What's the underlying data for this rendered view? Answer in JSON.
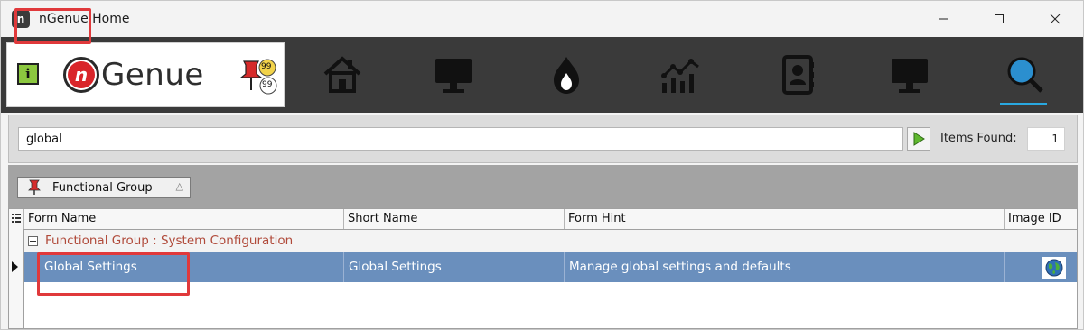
{
  "window": {
    "title": "nGenue Home",
    "app_icon_letter": "n"
  },
  "toolbar": {
    "info_label": "i",
    "logo_n": "n",
    "logo_text": "Genue",
    "badge_top": "99",
    "badge_bottom": "99",
    "nav_icons": [
      "home-icon",
      "monitor-icon",
      "flame-icon",
      "analytics-icon",
      "contacts-icon",
      "monitor-icon",
      "search-icon"
    ],
    "active_nav": "search-icon",
    "accent_color": "#29a8e0"
  },
  "search": {
    "value": "global",
    "items_found_label": "Items Found:",
    "items_found_value": "1"
  },
  "group_panel": {
    "chip_label": "Functional Group",
    "chip_sort_glyph": "△"
  },
  "grid": {
    "columns": [
      "Form Name",
      "Short Name",
      "Form Hint",
      "Image ID"
    ],
    "group_row_label": "Functional Group : System Configuration",
    "rows": [
      {
        "form_name": "Global Settings",
        "short_name": "Global Settings",
        "form_hint": "Manage global settings and defaults",
        "image_id_icon": "globe-icon"
      }
    ],
    "selected_row_color": "#6a8fbd",
    "group_text_color": "#b04a3a"
  },
  "highlight_color": "#e0393b"
}
